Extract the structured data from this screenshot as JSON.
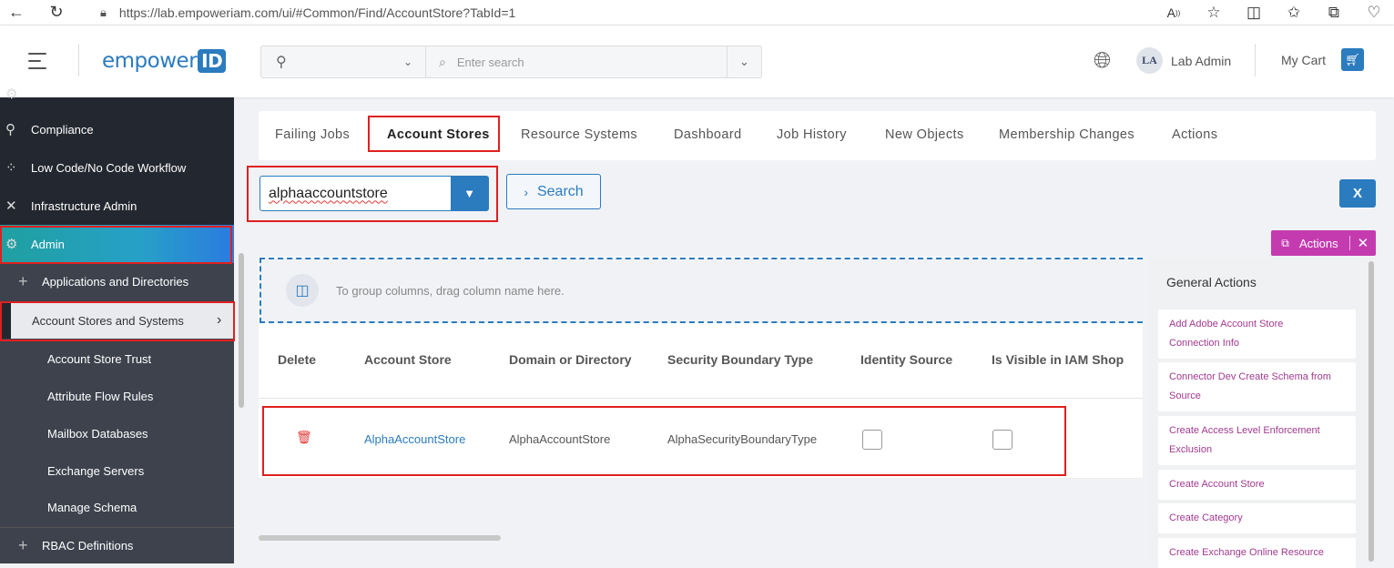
{
  "browser": {
    "url": "https://lab.empoweriam.com/ui/#Common/Find/AccountStore?TabId=1"
  },
  "header": {
    "logo_text": "empower",
    "logo_id": "ID",
    "search_placeholder": "Enter search",
    "user_initials": "LA",
    "user_name": "Lab Admin",
    "cart_label": "My Cart"
  },
  "sidebar": {
    "items": [
      {
        "label": "Compliance",
        "icon": "compliance-icon"
      },
      {
        "label": "Low Code/No Code Workflow",
        "icon": "workflow-icon"
      },
      {
        "label": "Infrastructure Admin",
        "icon": "tools-icon"
      },
      {
        "label": "Admin",
        "icon": "admin-gear-icon"
      }
    ],
    "sub_items": [
      {
        "label": "Applications and Directories"
      },
      {
        "label": "Account Stores and Systems"
      }
    ],
    "leaf_items": [
      {
        "label": "Account Store Trust"
      },
      {
        "label": "Attribute Flow Rules"
      },
      {
        "label": "Mailbox Databases"
      },
      {
        "label": "Exchange Servers"
      },
      {
        "label": "Manage Schema"
      }
    ],
    "bottom_item": {
      "label": "RBAC Definitions"
    }
  },
  "tabs": [
    {
      "label": "Failing Jobs"
    },
    {
      "label": "Account Stores"
    },
    {
      "label": "Resource Systems"
    },
    {
      "label": "Dashboard"
    },
    {
      "label": "Job History"
    },
    {
      "label": "New Objects"
    },
    {
      "label": "Membership Changes"
    },
    {
      "label": "Actions"
    }
  ],
  "filter": {
    "value": "alphaaccountstore",
    "search_label": "Search"
  },
  "grid": {
    "group_hint": "To group columns, drag column name here.",
    "columns": [
      "Delete",
      "Account Store",
      "Domain or Directory",
      "Security Boundary Type",
      "Identity Source",
      "Is Visible in IAM Shop"
    ],
    "rows": [
      {
        "account_store": "AlphaAccountStore",
        "domain": "AlphaAccountStore",
        "boundary_type": "AlphaSecurityBoundaryType",
        "identity_source": false,
        "visible_in_shop": false
      }
    ]
  },
  "actions_panel": {
    "tag_label": "Actions",
    "title": "General Actions",
    "items": [
      {
        "line1": "Add Adobe Account Store",
        "line2": "Connection Info"
      },
      {
        "line1": "Connector Dev Create Schema from",
        "line2": "Source"
      },
      {
        "line1": "Create Access Level Enforcement",
        "line2": "Exclusion"
      },
      {
        "line1": "Create Account Store",
        "line2": ""
      },
      {
        "line1": "Create Category",
        "line2": ""
      },
      {
        "line1": "Create Exchange Online Resource",
        "line2": ""
      }
    ]
  },
  "colors": {
    "brand_blue": "#2b7bbf",
    "sidebar_bg": "#23272f",
    "actions_magenta": "#c43bb0",
    "highlight_red": "#e02020"
  }
}
